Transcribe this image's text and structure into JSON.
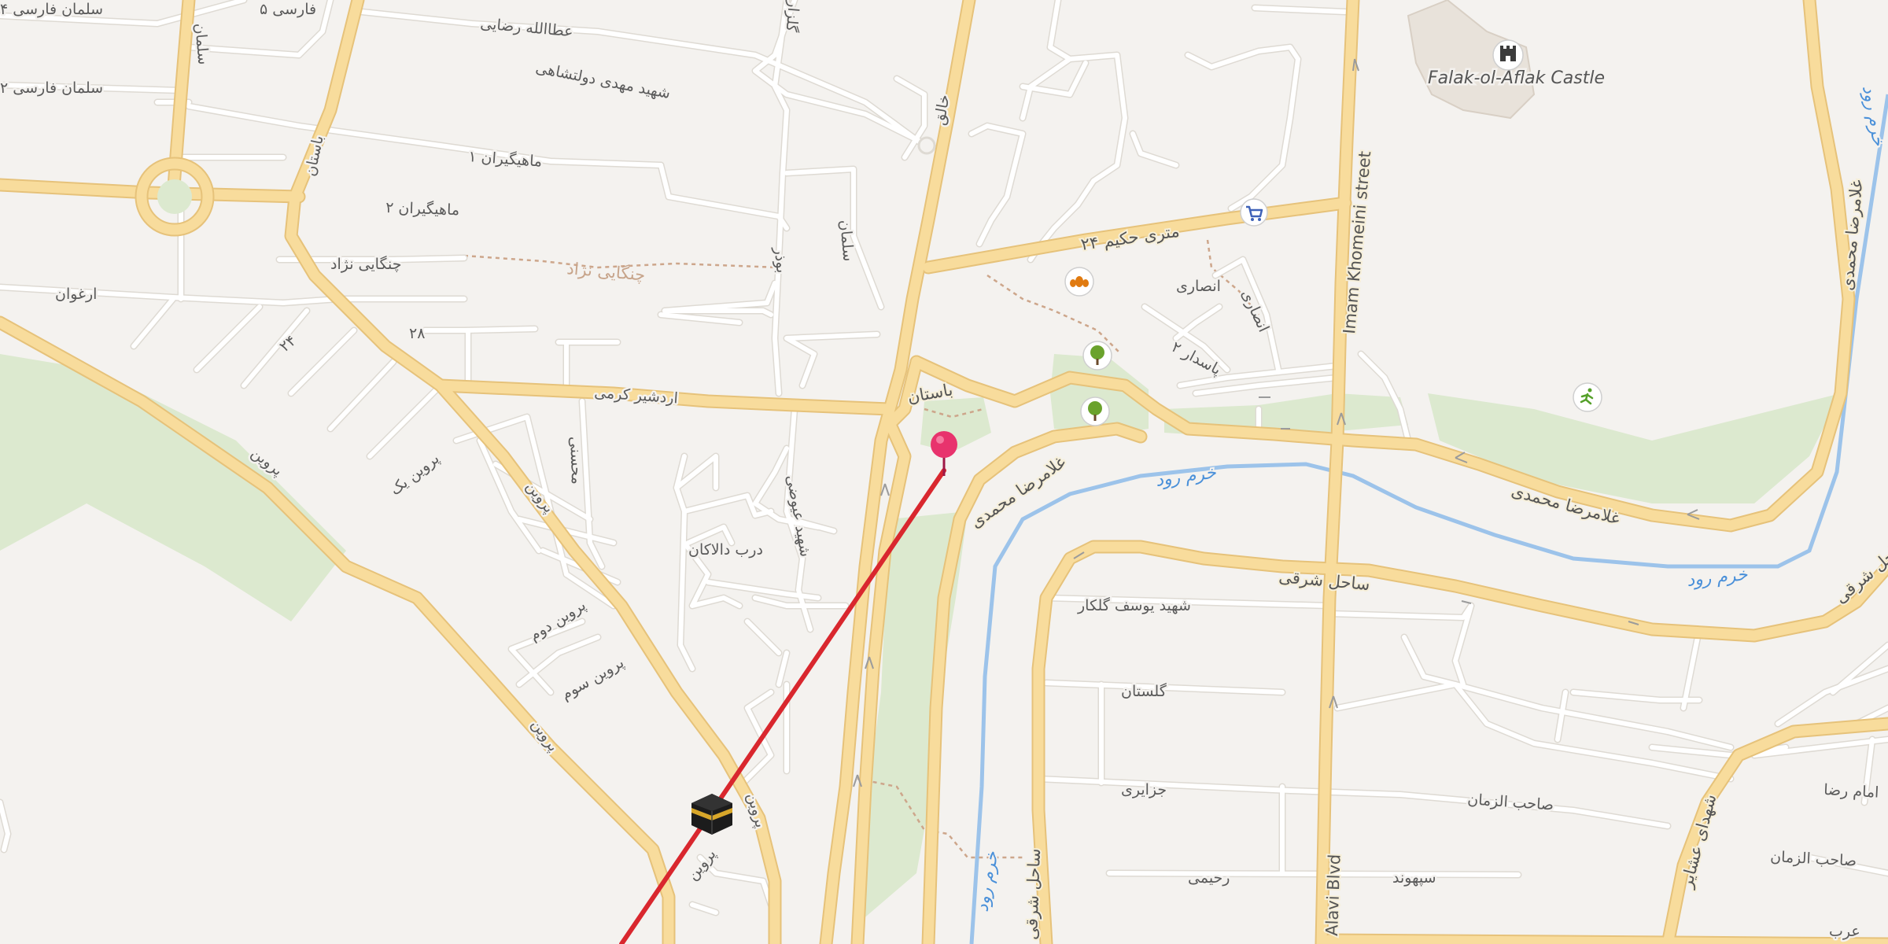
{
  "map": {
    "colors": {
      "background": "#f4f2ef",
      "primary_road": "#f8dc9c",
      "primary_road_casing": "#e6c27a",
      "minor_road": "#ffffff",
      "park": "#dce9cf",
      "river": "#9cc3ea",
      "route_line": "#d9272e",
      "pin": "#e8336d"
    },
    "labels": {
      "salman_farsi_4": "سلمان فارسی ۴",
      "farsi_5": "فارسی ۵",
      "salman_farsi_2": "سلمان فارسی ۲",
      "salman": "سلمان",
      "ataollah_razavi": "عطاالله رضایی",
      "shahid_mehdi": "شهید مهدی دولتشاهی",
      "golzar": "گلزار",
      "mahigiran_1": "ماهیگیران ۱",
      "mahigiran_2": "ماهیگیران ۲",
      "bostan_west": "باستان",
      "changaei_nejad": "چنگایی نژاد",
      "changaei_nejad_path": "چنگایی نژاد",
      "arghavan": "ارغوان",
      "st_24": "۲۴",
      "st_28": "۲۸",
      "ardashir_karami": "اردشیر کرمی",
      "parvin_1": "پروین",
      "parvin_2": "پروین",
      "parvin_3": "پروین",
      "parvin_4": "پروین",
      "parvin_yek": "پروین یک",
      "parvin_dovom": "پروین دوم",
      "parvin_sevom": "پروین سوم",
      "parvin_bottom": "پروین",
      "mohsen": "محسنی",
      "darb_dalakan": "درب دالاکان",
      "shahid_eyvazi": "شهید عیوضی",
      "salman_mid": "سلمان",
      "bozar": "بوذر",
      "khaleq": "خالق",
      "hakim_24m": "۲۴ متری حکیم",
      "ansari": "انصاری",
      "pasdaran_2": "پاسدار ۲",
      "bostan": "باستان",
      "golestan_upper": "گلستان",
      "gholamreza_mohammadi_1": "غلامرضا محمدی",
      "gholamreza_mohammadi_2": "غلامرضا محمدی",
      "gholamreza_mohammadi_3": "غلامرضا محمدی",
      "sahel_sharghi_1": "ساحل شرقی",
      "sahel_sharghi_2": "ساحل شرقی",
      "sahel_gharbi": "ساحل شرقی",
      "shahid_yousef_golkar": "شهید یوسف گلکار",
      "golestan": "گلستان",
      "jazayeri": "جزایری",
      "sahebozzaman_1": "صاحب الزمان",
      "sahebozzaman_2": "صاحب الزمان",
      "rahimi": "رحیمی",
      "sepahvand": "سپهوند",
      "imam_reza": "امام رضا",
      "arab": "عرب",
      "shohada_ashayer": "شهدای عشایر",
      "falak_castle": "Falak-ol-Aflak Castle",
      "imam_khomeini": "Imam Khomeini street",
      "alavi_blvd": "Alavi Blvd",
      "khoram_rud_1": "خرم رود",
      "khoram_rud_2": "خرم رود",
      "khoram_rud_3": "خرم رود",
      "khoram_rud_4": "خرم رود",
      "parvin_street": "پروین"
    },
    "pois": {
      "castle": "castle-icon",
      "shop": "shopping-cart-icon",
      "bakery": "bakery-icon",
      "park_1": "tree-icon",
      "park_2": "tree-icon",
      "sport": "running-icon",
      "kaaba": "kaaba-icon",
      "marker": "location-pin-icon"
    }
  }
}
